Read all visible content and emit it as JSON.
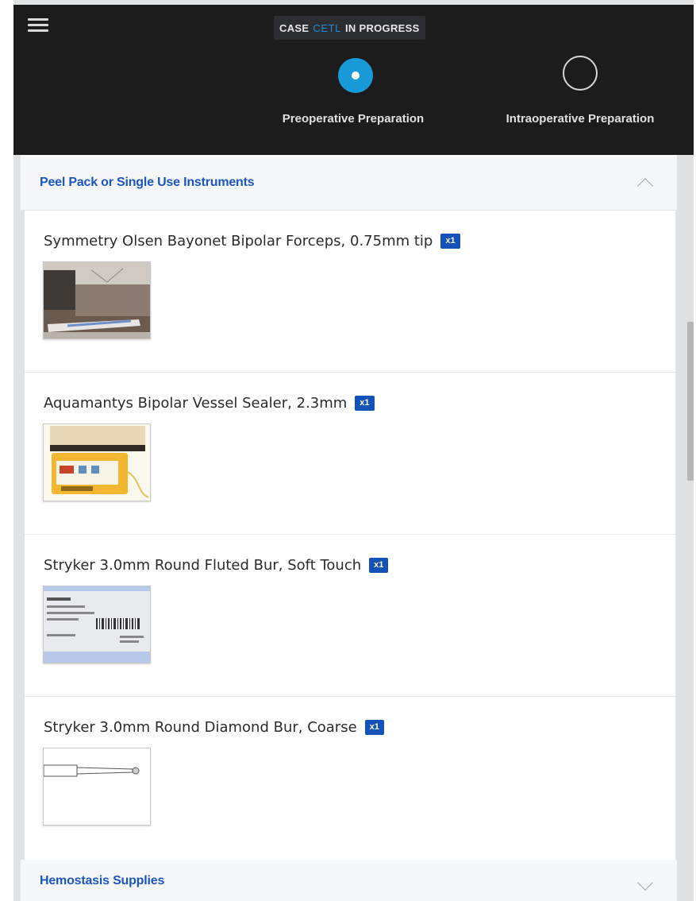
{
  "header": {
    "status": {
      "prefix": "CASE",
      "code": "CETL",
      "suffix": "IN PROGRESS"
    },
    "steps": [
      {
        "label": "Preoperative Preparation",
        "state": "active"
      },
      {
        "label": "Intraoperative Preparation",
        "state": "inactive"
      }
    ],
    "icons": {
      "menu": "hamburger-menu-icon"
    }
  },
  "sections": [
    {
      "title": "Peel Pack or Single Use Instruments",
      "expanded": true,
      "items": [
        {
          "name": "Symmetry Olsen Bayonet Bipolar Forceps, 0.75mm tip",
          "qty": "x1"
        },
        {
          "name": "Aquamantys Bipolar Vessel Sealer, 2.3mm",
          "qty": "x1"
        },
        {
          "name": "Stryker 3.0mm Round Fluted Bur, Soft Touch",
          "qty": "x1"
        },
        {
          "name": "Stryker 3.0mm Round Diamond Bur, Coarse",
          "qty": "x1"
        }
      ]
    },
    {
      "title": "Hemostasis Supplies",
      "expanded": false
    }
  ],
  "colors": {
    "header_bg": "#1c1c1c",
    "accent": "#179ad7",
    "section_title": "#1b56c0",
    "qty_badge": "#1452b8"
  }
}
